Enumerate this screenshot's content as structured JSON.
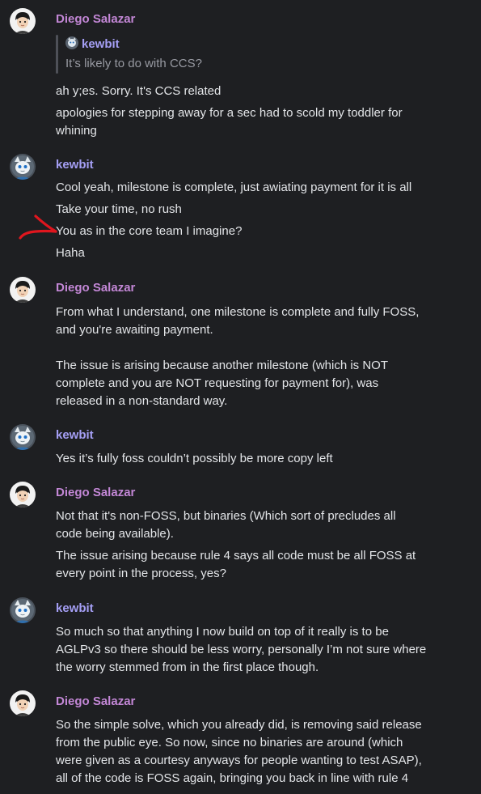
{
  "users": {
    "diego": {
      "name": "Diego Salazar",
      "color": "#c387d6"
    },
    "kewbit": {
      "name": "kewbit",
      "color": "#a59ff5"
    }
  },
  "reply_quote": {
    "author": "kewbit",
    "text": "It’s likely to do with CCS?"
  },
  "messages": [
    {
      "author": "Diego Salazar",
      "lines": [
        "ah y;es. Sorry. It's CCS related",
        "apologies for stepping away for a sec had to scold my toddler for",
        "whining"
      ]
    },
    {
      "author": "kewbit",
      "lines": [
        "Cool yeah, milestone is complete, just awiating payment for it is all",
        "Take your time, no rush",
        "You as in the core team I imagine?",
        "Haha"
      ]
    },
    {
      "author": "Diego Salazar",
      "lines": [
        "From what I understand, one milestone is complete and fully FOSS,",
        "and you're awaiting payment.",
        "The issue is arising because another milestone (which is NOT",
        "complete and you are NOT requesting for payment for), was",
        "released in a non-standard way."
      ]
    },
    {
      "author": "kewbit",
      "lines": [
        "Yes it’s fully foss couldn’t possibly be more copy left"
      ]
    },
    {
      "author": "Diego Salazar",
      "lines": [
        "Not that it's non-FOSS, but binaries (Which sort of precludes all",
        "code being available).",
        "The issue arising because rule 4 says all code must be all FOSS at",
        "every point in the process, yes?"
      ]
    },
    {
      "author": "kewbit",
      "lines": [
        "So much so that anything I now build on top of it really is to be",
        "AGLPv3 so there should be less worry, personally I’m not sure where",
        "the worry stemmed from in the first place though."
      ]
    },
    {
      "author": "Diego Salazar",
      "lines": [
        "So the simple solve, which you already did, is removing said release",
        "from the public eye. So now, since no binaries are around (which",
        "were given as a courtesy anyways for people wanting to test ASAP),",
        "all of the code is FOSS again, bringing you back in line with rule 4"
      ]
    }
  ],
  "annotation": {
    "type": "red-arrow",
    "color": "#e0161e"
  }
}
